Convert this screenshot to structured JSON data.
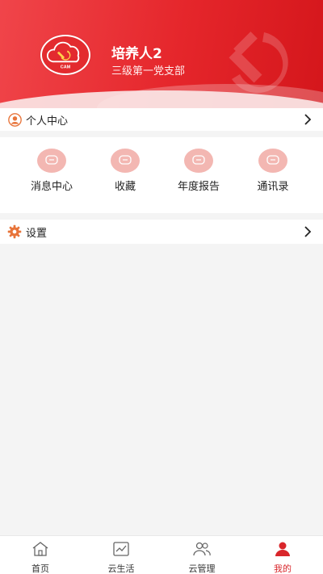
{
  "header": {
    "user_name": "培养人2",
    "branch": "三级第一党支部",
    "logo_text": "CAM"
  },
  "personal_center": {
    "label": "个人中心"
  },
  "quick_actions": [
    {
      "label": "消息中心",
      "icon": "message-icon"
    },
    {
      "label": "收藏",
      "icon": "message-icon"
    },
    {
      "label": "年度报告",
      "icon": "message-icon"
    },
    {
      "label": "通讯录",
      "icon": "message-icon"
    }
  ],
  "settings": {
    "label": "设置"
  },
  "tabbar": {
    "tabs": [
      {
        "label": "首页",
        "icon": "home-icon"
      },
      {
        "label": "云生活",
        "icon": "chart-icon"
      },
      {
        "label": "云管理",
        "icon": "users-icon"
      },
      {
        "label": "我的",
        "icon": "person-icon",
        "active": true
      }
    ]
  },
  "colors": {
    "accent": "#e5262b",
    "icon_bg": "#f3b7b2",
    "settings_icon": "#e8743a"
  }
}
